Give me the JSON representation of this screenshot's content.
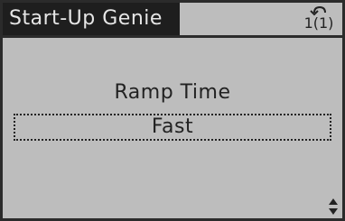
{
  "header": {
    "title": "Start-Up Genie",
    "page_indicator": "1(1)",
    "back_icon": "back-arrow-icon"
  },
  "main": {
    "parameter_label": "Ramp Time",
    "parameter_value": "Fast"
  },
  "scroll_icon": "up-down-arrows-icon",
  "colors": {
    "display_background": "#bdbdbd",
    "title_background": "#1e1e1e",
    "title_text": "#e6e6e6",
    "text": "#222222",
    "border": "#2b2b2b"
  }
}
